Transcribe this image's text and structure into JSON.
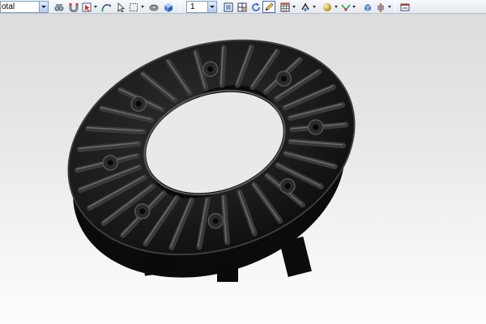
{
  "toolbar": {
    "layer_combo_value": "otal",
    "view_combo_value": "1",
    "icons": [
      "binoculars-icon",
      "magnet-icon",
      "selection-filter-icon",
      "curve-icon",
      "dotted-rectangle-icon",
      "shaded-solid-icon",
      "single-view-icon",
      "multi-view-icon",
      "refresh-icon",
      "pencil-icon",
      "grid-icon",
      "snap-icon",
      "sphere-icon",
      "trim-icon",
      "orient-icon",
      "section-icon",
      "fit-icon"
    ]
  },
  "viewport": {
    "model": "ribbed-annular-disc",
    "model_color": "#1a1a1a",
    "background_top": "#dcdcdc",
    "background_bottom": "#fdfdfd"
  }
}
